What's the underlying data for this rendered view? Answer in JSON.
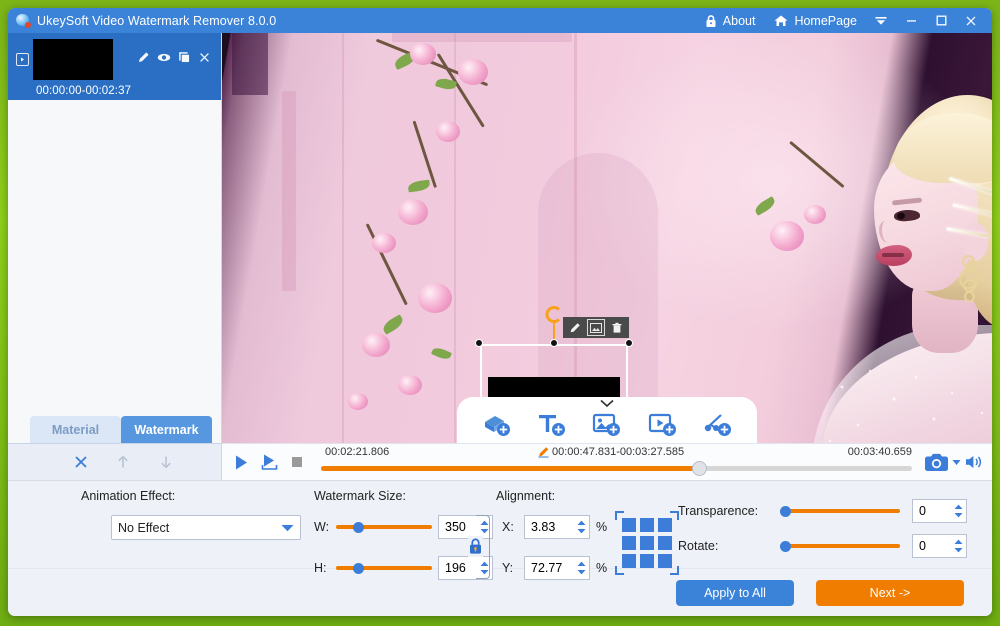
{
  "app": {
    "title": "UkeySoft Video Watermark Remover 8.0.0",
    "logo_icon": "app-logo-icon"
  },
  "titlebar": {
    "lock_icon": "lock-icon",
    "about_label": "About",
    "home_icon": "home-icon",
    "homepage_label": "HomePage",
    "dropdown_icon": "chevron-down-icon",
    "minimize_icon": "minimize-icon",
    "maximize_icon": "maximize-icon",
    "close_icon": "close-icon"
  },
  "media": {
    "item": {
      "play_icon": "play-small-icon",
      "thumbnail": "video-thumbnail",
      "time_range": "00:00:00-00:02:37",
      "edit_icon": "pencil-icon",
      "preview_icon": "eye-icon",
      "duplicate_icon": "copy-icon",
      "remove_icon": "close-icon"
    }
  },
  "tabs": {
    "material_label": "Material",
    "watermark_label": "Watermark",
    "active": "Watermark"
  },
  "tab_actions": {
    "delete_icon": "close-icon",
    "move_up_icon": "arrow-up-icon",
    "move_down_icon": "arrow-down-icon"
  },
  "preview": {
    "watermark_tools": {
      "edit_icon": "pencil-icon",
      "replace_icon": "image-swap-icon",
      "delete_icon": "trash-icon"
    },
    "rotate_handle_icon": "rotate-handle-icon",
    "add_toolbar": {
      "collapse_icon": "chevron-down-icon",
      "items": [
        {
          "name": "add-mosaic-button",
          "icon": "mosaic-add-icon"
        },
        {
          "name": "add-text-button",
          "icon": "text-add-icon"
        },
        {
          "name": "add-image-button",
          "icon": "image-add-icon"
        },
        {
          "name": "add-video-button",
          "icon": "video-add-icon"
        },
        {
          "name": "add-effect-button",
          "icon": "effect-add-icon"
        }
      ]
    }
  },
  "timeline": {
    "play_icon": "play-icon",
    "play_selection_icon": "play-selection-icon",
    "stop_icon": "stop-icon",
    "current_time": "00:02:21.806",
    "trim_edit_icon": "pencil-icon",
    "selection_range": "00:00:47.831-00:03:27.585",
    "total_time": "00:03:40.659",
    "progress_percent": 64,
    "snapshot_icon": "camera-icon",
    "snapshot_caret_icon": "chevron-down-icon",
    "volume_icon": "speaker-icon"
  },
  "controls": {
    "animation": {
      "label": "Animation Effect:",
      "value": "No Effect",
      "caret_icon": "chevron-down-icon"
    },
    "size": {
      "label": "Watermark Size:",
      "width_label": "W:",
      "width_value": "350",
      "width_slider_percent": 20,
      "height_label": "H:",
      "height_value": "196",
      "height_slider_percent": 20,
      "lock_icon": "lock-icon"
    },
    "alignment": {
      "label": "Alignment:",
      "x_label": "X:",
      "x_value": "3.83",
      "x_unit": "%",
      "y_label": "Y:",
      "y_value": "72.77",
      "y_unit": "%",
      "grid_icon": "alignment-grid-icon"
    },
    "transparence": {
      "label": "Transparence:",
      "value": "0",
      "slider_percent": 0
    },
    "rotate": {
      "label": "Rotate:",
      "value": "0",
      "slider_percent": 0
    }
  },
  "footer": {
    "apply_all_label": "Apply to All",
    "next_label": "Next ->",
    "apply_color": "#3b83d8",
    "next_color": "#f07c00"
  },
  "theme": {
    "titlebar": "#3b83d8",
    "accent_orange": "#f07c00",
    "accent_blue": "#3b7dd8",
    "panel_bg": "#eef1f7",
    "tab_active": "#5697e0"
  }
}
